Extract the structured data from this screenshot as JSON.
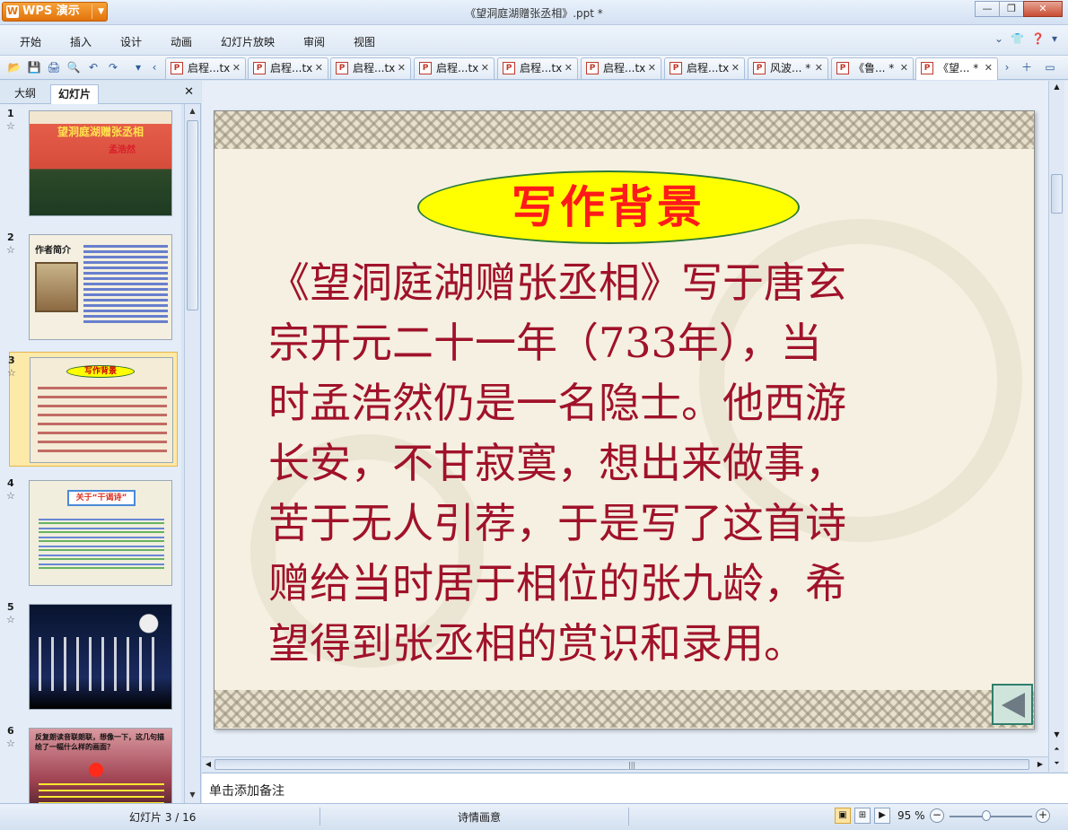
{
  "app": {
    "name": "WPS 演示",
    "document_title": "《望洞庭湖赠张丞相》.ppt *"
  },
  "menu": [
    "开始",
    "插入",
    "设计",
    "动画",
    "幻灯片放映",
    "审阅",
    "视图"
  ],
  "doc_tabs": [
    {
      "label": "启程...tx"
    },
    {
      "label": "启程...tx"
    },
    {
      "label": "启程...tx"
    },
    {
      "label": "启程...tx"
    },
    {
      "label": "启程...tx"
    },
    {
      "label": "启程...tx"
    },
    {
      "label": "启程...tx"
    },
    {
      "label": "风波... *"
    },
    {
      "label": "《鲁... *"
    },
    {
      "label": "《望... *"
    }
  ],
  "left_panel": {
    "tabs": [
      "大纲",
      "幻灯片"
    ],
    "slides": [
      {
        "num": "1",
        "title": "望洞庭湖赠张丞相",
        "author": "孟浩然"
      },
      {
        "num": "2",
        "title": "作者简介"
      },
      {
        "num": "3",
        "title": "写作背景",
        "selected": true
      },
      {
        "num": "4",
        "title": "关于“干谒诗”"
      },
      {
        "num": "5"
      },
      {
        "num": "6",
        "title": "反复朗读音联朗联，想像一下，这几句描绘了一幅什么样的画面？"
      }
    ]
  },
  "slide": {
    "title": "写作背景",
    "body_lines": [
      "《望洞庭湖赠张丞相》写于唐玄",
      "宗开元二十一年（733年），当",
      "时孟浩然仍是一名隐士。他西游",
      "长安，不甘寂寞，想出来做事，",
      "苦于无人引荐，于是写了这首诗",
      "赠给当时居于相位的张九龄，希",
      "望得到张丞相的赏识和录用。"
    ]
  },
  "notes": {
    "placeholder": "单击添加备注"
  },
  "status": {
    "slide_info": "幻灯片 3 / 16",
    "theme": "诗情画意",
    "zoom": "95 %"
  }
}
